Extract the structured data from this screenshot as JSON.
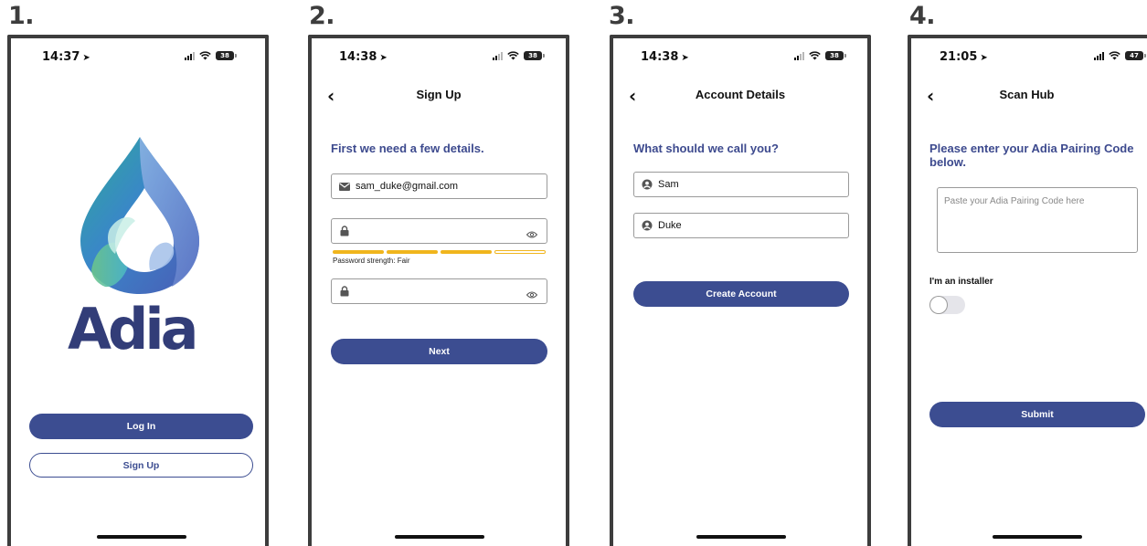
{
  "steps": [
    {
      "number": "1.",
      "time": "14:37",
      "battery": "38"
    },
    {
      "number": "2.",
      "time": "14:38",
      "battery": "38",
      "title": "Sign Up"
    },
    {
      "number": "3.",
      "time": "14:38",
      "battery": "38",
      "title": "Account Details"
    },
    {
      "number": "4.",
      "time": "21:05",
      "battery": "47",
      "title": "Scan Hub"
    }
  ],
  "welcome": {
    "logo_text": "Adia",
    "login_label": "Log In",
    "signup_label": "Sign Up"
  },
  "signup": {
    "heading": "First we need a few details.",
    "email_value": "sam_duke@gmail.com",
    "password_strength_label": "Password strength: Fair",
    "password_strength_level": 0.75,
    "next_label": "Next"
  },
  "account": {
    "heading": "What should we call you?",
    "first_name": "Sam",
    "last_name": "Duke",
    "create_label": "Create Account"
  },
  "scanhub": {
    "heading": "Please enter your Adia Pairing Code below.",
    "code_placeholder": "Paste your Adia Pairing Code here",
    "installer_label": "I'm an installer",
    "installer_on": false,
    "submit_label": "Submit"
  },
  "colors": {
    "brand": "#3c4d91",
    "heading": "#3d4a8e",
    "strength": "#f0b51d"
  }
}
